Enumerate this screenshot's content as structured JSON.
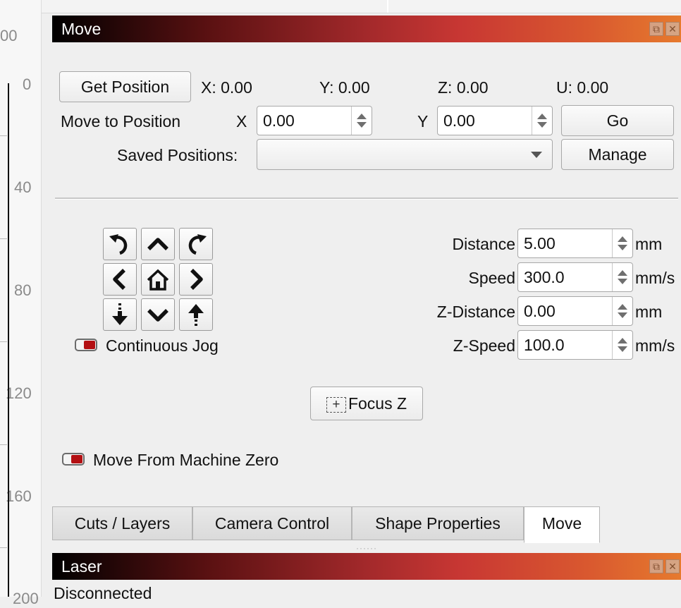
{
  "ruler": {
    "labels": [
      "00",
      "0",
      "40",
      "80",
      "120",
      "160",
      "200"
    ]
  },
  "move_panel": {
    "title": "Move",
    "title_icons": [
      "float-icon",
      "close-icon"
    ],
    "get_position_label": "Get Position",
    "positions": {
      "x": "X: 0.00",
      "y": "Y: 0.00",
      "z": "Z: 0.00",
      "u": "U: 0.00"
    },
    "move_to_label": "Move to Position",
    "x_label": "X",
    "x_value": "0.00",
    "y_label": "Y",
    "y_value": "0.00",
    "go_label": "Go",
    "saved_positions_label": "Saved Positions:",
    "saved_positions_value": "",
    "manage_label": "Manage",
    "jog_buttons": [
      "rotate-ccw-icon",
      "arrow-up-icon",
      "rotate-cw-icon",
      "arrow-left-icon",
      "home-icon",
      "arrow-right-icon",
      "z-down-icon",
      "arrow-down-icon",
      "z-up-icon"
    ],
    "continuous_jog_label": "Continuous Jog",
    "continuous_jog_on": false,
    "distance": {
      "label": "Distance",
      "value": "5.00",
      "unit": "mm"
    },
    "speed": {
      "label": "Speed",
      "value": "300.0",
      "unit": "mm/s"
    },
    "z_distance": {
      "label": "Z-Distance",
      "value": "0.00",
      "unit": "mm"
    },
    "z_speed": {
      "label": "Z-Speed",
      "value": "100.0",
      "unit": "mm/s"
    },
    "focus_z_label": "Focus Z",
    "move_from_zero_label": "Move From Machine Zero",
    "move_from_zero_on": false
  },
  "tabs": [
    {
      "label": "Cuts / Layers",
      "active": false
    },
    {
      "label": "Camera Control",
      "active": false
    },
    {
      "label": "Shape Properties",
      "active": false
    },
    {
      "label": "Move",
      "active": true
    }
  ],
  "laser_panel": {
    "title": "Laser",
    "status": "Disconnected"
  },
  "colors": {
    "toggle_accent": "#b30f12",
    "title_gradient_end": "#e67a2e"
  }
}
